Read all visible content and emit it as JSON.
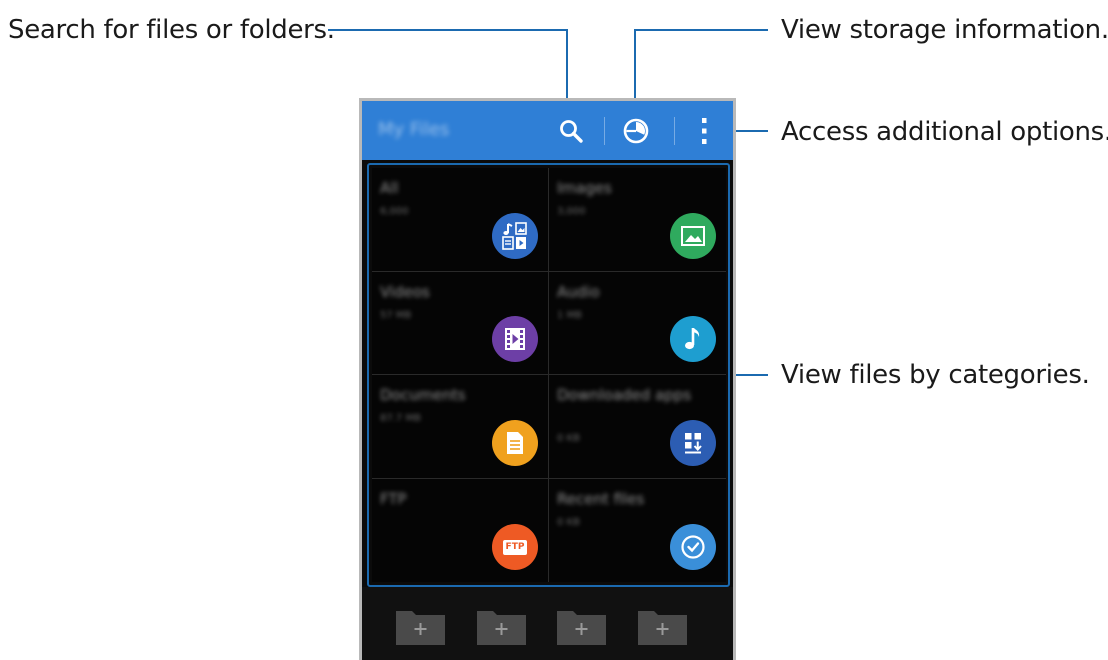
{
  "callouts": {
    "search": "Search for files or folders.",
    "storage": "View storage information.",
    "options": "Access additional options.",
    "categories": "View files by categories."
  },
  "action_bar": {
    "title": "My Files",
    "color": "#2f7fd6",
    "icons": [
      "search-icon",
      "storage-icon",
      "more-options-icon"
    ]
  },
  "categories": [
    {
      "name": "All",
      "count": "6,000",
      "icon": "all-files-icon",
      "color": "#2f6bc4"
    },
    {
      "name": "Images",
      "count": "3,000",
      "icon": "images-icon",
      "color": "#2faa5e"
    },
    {
      "name": "Videos",
      "count": "57 MB",
      "icon": "videos-icon",
      "color": "#6d3fa6"
    },
    {
      "name": "Audio",
      "count": "1 MB",
      "icon": "audio-icon",
      "color": "#1e9ed0"
    },
    {
      "name": "Documents",
      "count": "87.7 MB",
      "icon": "documents-icon",
      "color": "#f0a11e"
    },
    {
      "name": "Downloaded apps",
      "count": "0 KB",
      "icon": "downloaded-apps-icon",
      "color": "#2c5db3"
    },
    {
      "name": "FTP",
      "count": "",
      "icon": "ftp-icon",
      "color": "#ee5a24",
      "badge": "FTP"
    },
    {
      "name": "Recent files",
      "count": "0 KB",
      "icon": "recent-files-icon",
      "color": "#3a8fd9"
    }
  ],
  "shortcut_folders": [
    "add-folder-icon",
    "add-folder-icon",
    "add-folder-icon",
    "add-folder-icon"
  ]
}
